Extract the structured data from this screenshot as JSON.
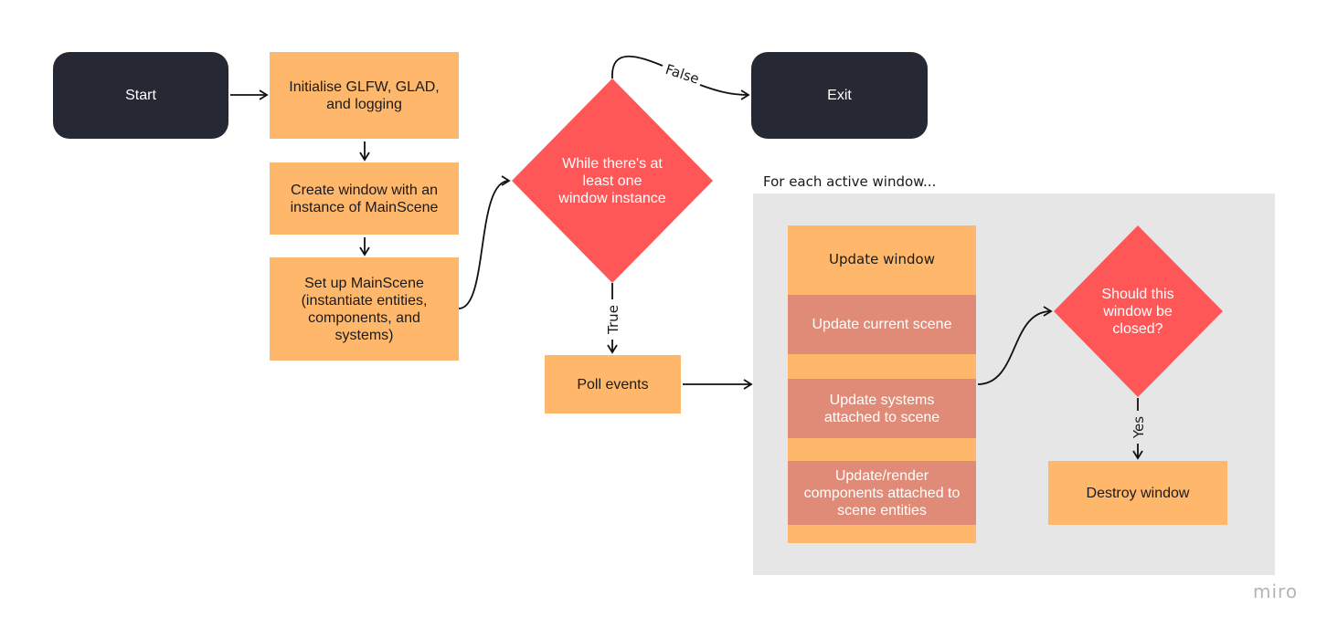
{
  "nodes": {
    "start": "Start",
    "init": "Initialise GLFW, GLAD, and logging",
    "create_window": "Create window with an instance of MainScene",
    "setup": "Set up MainScene (instantiate entities, components, and systems)",
    "loop_decision": "While there's at least one window instance",
    "exit": "Exit",
    "poll_events": "Poll events",
    "update_window": "Update window",
    "update_scene": "Update current scene",
    "update_systems": "Update systems attached to scene",
    "update_components": "Update/render components attached to scene entities",
    "close_decision": "Should this window be closed?",
    "destroy_window": "Destroy window"
  },
  "group": {
    "label": "For each active window..."
  },
  "edges": {
    "false_label": "False",
    "true_label": "True",
    "yes_label": "Yes"
  },
  "branding": {
    "logo": "miro"
  },
  "colors": {
    "terminal": "#262833",
    "process": "#ffb86b",
    "subprocess": "#e08b77",
    "decision": "#ff5757",
    "group": "#e6e6e6"
  }
}
